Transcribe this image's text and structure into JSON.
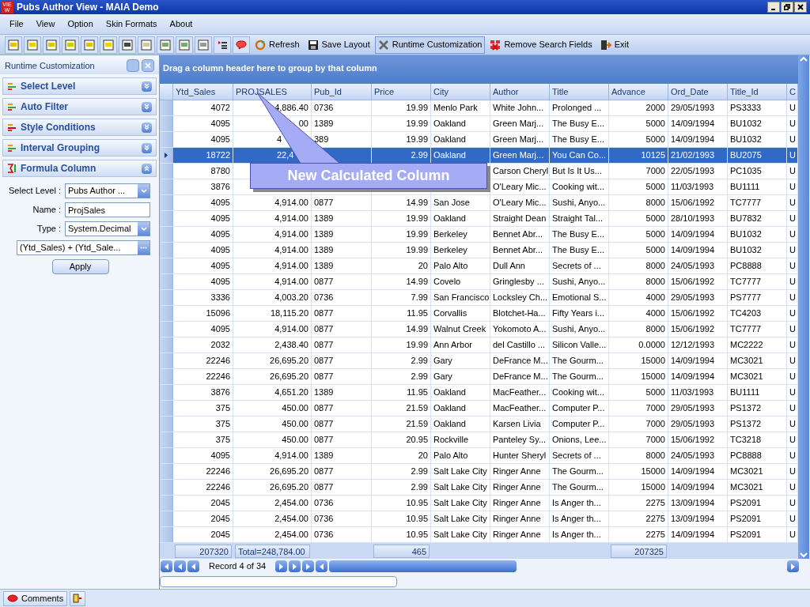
{
  "window": {
    "title": "Pubs Author View - MAIA Demo",
    "app_icon": "VIEW"
  },
  "menu": [
    "File",
    "View",
    "Option",
    "Skin Formats",
    "About"
  ],
  "toolbar": [
    {
      "label": "Refresh",
      "selected": false
    },
    {
      "label": "Save Layout",
      "selected": false
    },
    {
      "label": "Runtime Customization",
      "selected": true
    },
    {
      "label": "Remove Search Fields",
      "selected": false
    },
    {
      "label": "Exit",
      "selected": false
    }
  ],
  "panel": {
    "title": "Runtime Customization",
    "sections": [
      {
        "label": "Select Level",
        "expanded": false
      },
      {
        "label": "Auto Filter",
        "expanded": false
      },
      {
        "label": "Style Conditions",
        "expanded": false
      },
      {
        "label": "Interval Grouping",
        "expanded": false
      },
      {
        "label": "Formula Column",
        "expanded": true
      }
    ],
    "form": {
      "select_level_label": "Select Level :",
      "select_level": "Pubs Author ...",
      "name_label": "Name :",
      "name": "ProjSales",
      "type_label": "Type :",
      "type": "System.Decimal",
      "formula": "(Ytd_Sales) + (Ytd_Sale...",
      "apply": "Apply"
    }
  },
  "grid": {
    "group_hint": "Drag a column header here to group by that column",
    "columns": [
      "Ytd_Sales",
      "PROJSALES",
      "Pub_Id",
      "Price",
      "City",
      "Author",
      "Title",
      "Advance",
      "Ord_Date",
      "Title_Id",
      "C"
    ],
    "rows": [
      {
        "selected": false,
        "cells": [
          "4072",
          "4,886.40",
          "0736",
          "19.99",
          "Menlo Park",
          "White John...",
          "Prolonged ...",
          "2000",
          "29/05/1993",
          "PS3333",
          "U"
        ]
      },
      {
        "selected": false,
        "cells": [
          "4095",
          "00",
          "1389",
          "19.99",
          "Oakland",
          "Green Marj...",
          "The Busy E...",
          "5000",
          "14/09/1994",
          "BU1032",
          "U"
        ]
      },
      {
        "selected": false,
        "cells": [
          "4095",
          {
            "text": "4",
            "cut": true
          },
          "389",
          "19.99",
          "Oakland",
          "Green Marj...",
          "The Busy E...",
          "5000",
          "14/09/1994",
          "BU1032",
          "U"
        ]
      },
      {
        "selected": true,
        "cells": [
          "18722",
          {
            "text": "22,4",
            "cut": true
          },
          null,
          "2.99",
          "Oakland",
          "Green Marj...",
          "You Can Co...",
          "10125",
          "21/02/1993",
          "BU2075",
          "U"
        ]
      },
      {
        "selected": false,
        "cells": [
          "8780",
          null,
          null,
          null,
          null,
          "Carson Cheryl",
          "But Is It Us...",
          "7000",
          "22/05/1993",
          "PC1035",
          "U"
        ]
      },
      {
        "selected": false,
        "cells": [
          "3876",
          null,
          null,
          null,
          null,
          "O'Leary Mic...",
          "Cooking wit...",
          "5000",
          "11/03/1993",
          "BU1111",
          "U"
        ]
      },
      {
        "selected": false,
        "cells": [
          "4095",
          "4,914.00",
          "0877",
          "14.99",
          "San Jose",
          "O'Leary Mic...",
          "Sushi, Anyo...",
          "8000",
          "15/06/1992",
          "TC7777",
          "U"
        ]
      },
      {
        "selected": false,
        "cells": [
          "4095",
          "4,914.00",
          "1389",
          "19.99",
          "Oakland",
          "Straight Dean",
          "Straight Tal...",
          "5000",
          "28/10/1993",
          "BU7832",
          "U"
        ]
      },
      {
        "selected": false,
        "cells": [
          "4095",
          "4,914.00",
          "1389",
          "19.99",
          "Berkeley",
          "Bennet Abr...",
          "The Busy E...",
          "5000",
          "14/09/1994",
          "BU1032",
          "U"
        ]
      },
      {
        "selected": false,
        "cells": [
          "4095",
          "4,914.00",
          "1389",
          "19.99",
          "Berkeley",
          "Bennet Abr...",
          "The Busy E...",
          "5000",
          "14/09/1994",
          "BU1032",
          "U"
        ]
      },
      {
        "selected": false,
        "cells": [
          "4095",
          "4,914.00",
          "1389",
          "20",
          "Palo Alto",
          "Dull Ann",
          "Secrets of ...",
          "8000",
          "24/05/1993",
          "PC8888",
          "U"
        ]
      },
      {
        "selected": false,
        "cells": [
          "4095",
          "4,914.00",
          "0877",
          "14.99",
          "Covelo",
          "Gringlesby ...",
          "Sushi, Anyo...",
          "8000",
          "15/06/1992",
          "TC7777",
          "U"
        ]
      },
      {
        "selected": false,
        "cells": [
          "3336",
          "4,003.20",
          "0736",
          "7.99",
          "San Francisco",
          "Locksley Ch...",
          "Emotional S...",
          "4000",
          "29/05/1993",
          "PS7777",
          "U"
        ]
      },
      {
        "selected": false,
        "cells": [
          "15096",
          "18,115.20",
          "0877",
          "11.95",
          "Corvallis",
          "Blotchet-Ha...",
          "Fifty Years i...",
          "4000",
          "15/06/1992",
          "TC4203",
          "U"
        ]
      },
      {
        "selected": false,
        "cells": [
          "4095",
          "4,914.00",
          "0877",
          "14.99",
          "Walnut Creek",
          "Yokomoto A...",
          "Sushi, Anyo...",
          "8000",
          "15/06/1992",
          "TC7777",
          "U"
        ]
      },
      {
        "selected": false,
        "cells": [
          "2032",
          "2,438.40",
          "0877",
          "19.99",
          "Ann Arbor",
          "del Castillo ...",
          "Silicon Valle...",
          "0.0000",
          "12/12/1993",
          "MC2222",
          "U"
        ]
      },
      {
        "selected": false,
        "cells": [
          "22246",
          "26,695.20",
          "0877",
          "2.99",
          "Gary",
          "DeFrance M...",
          "The Gourm...",
          "15000",
          "14/09/1994",
          "MC3021",
          "U"
        ]
      },
      {
        "selected": false,
        "cells": [
          "22246",
          "26,695.20",
          "0877",
          "2.99",
          "Gary",
          "DeFrance M...",
          "The Gourm...",
          "15000",
          "14/09/1994",
          "MC3021",
          "U"
        ]
      },
      {
        "selected": false,
        "cells": [
          "3876",
          "4,651.20",
          "1389",
          "11.95",
          "Oakland",
          "MacFeather...",
          "Cooking wit...",
          "5000",
          "11/03/1993",
          "BU1111",
          "U"
        ]
      },
      {
        "selected": false,
        "cells": [
          "375",
          "450.00",
          "0877",
          "21.59",
          "Oakland",
          "MacFeather...",
          "Computer P...",
          "7000",
          "29/05/1993",
          "PS1372",
          "U"
        ]
      },
      {
        "selected": false,
        "cells": [
          "375",
          "450.00",
          "0877",
          "21.59",
          "Oakland",
          "Karsen Livia",
          "Computer P...",
          "7000",
          "29/05/1993",
          "PS1372",
          "U"
        ]
      },
      {
        "selected": false,
        "cells": [
          "375",
          "450.00",
          "0877",
          "20.95",
          "Rockville",
          "Panteley Sy...",
          "Onions, Lee...",
          "7000",
          "15/06/1992",
          "TC3218",
          "U"
        ]
      },
      {
        "selected": false,
        "cells": [
          "4095",
          "4,914.00",
          "1389",
          "20",
          "Palo Alto",
          "Hunter Sheryl",
          "Secrets of ...",
          "8000",
          "24/05/1993",
          "PC8888",
          "U"
        ]
      },
      {
        "selected": false,
        "cells": [
          "22246",
          "26,695.20",
          "0877",
          "2.99",
          "Salt Lake City",
          "Ringer Anne",
          "The Gourm...",
          "15000",
          "14/09/1994",
          "MC3021",
          "U"
        ]
      },
      {
        "selected": false,
        "cells": [
          "22246",
          "26,695.20",
          "0877",
          "2.99",
          "Salt Lake City",
          "Ringer Anne",
          "The Gourm...",
          "15000",
          "14/09/1994",
          "MC3021",
          "U"
        ]
      },
      {
        "selected": false,
        "cells": [
          "2045",
          "2,454.00",
          "0736",
          "10.95",
          "Salt Lake City",
          "Ringer Anne",
          "Is Anger th...",
          "2275",
          "13/09/1994",
          "PS2091",
          "U"
        ]
      },
      {
        "selected": false,
        "cells": [
          "2045",
          "2,454.00",
          "0736",
          "10.95",
          "Salt Lake City",
          "Ringer Anne",
          "Is Anger th...",
          "2275",
          "13/09/1994",
          "PS2091",
          "U"
        ]
      },
      {
        "selected": false,
        "cells": [
          "2045",
          "2,454.00",
          "0736",
          "10.95",
          "Salt Lake City",
          "Ringer Anne",
          "Is Anger th...",
          "2275",
          "14/09/1994",
          "PS2091",
          "U"
        ]
      }
    ],
    "footer": {
      "ytd_sales": "207320",
      "projsales": "Total=248,784.00",
      "price": "465",
      "advance": "207325"
    },
    "navigator": "Record 4 of 34"
  },
  "callout": "New Calculated Column",
  "status_bar": {
    "tab": "Comments"
  }
}
